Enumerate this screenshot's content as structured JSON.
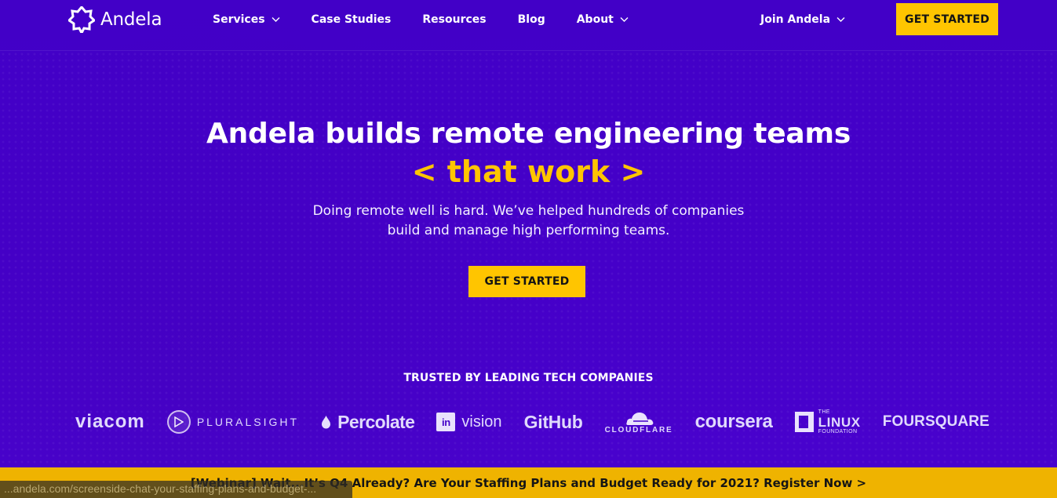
{
  "nav": {
    "brand": "Andela",
    "items": [
      {
        "label": "Services",
        "has_dropdown": true,
        "icon": "chevron-down-icon"
      },
      {
        "label": "Case Studies",
        "has_dropdown": false
      },
      {
        "label": "Resources",
        "has_dropdown": false
      },
      {
        "label": "Blog",
        "has_dropdown": false
      },
      {
        "label": "About",
        "has_dropdown": true,
        "icon": "chevron-down-icon"
      }
    ],
    "join": "Join Andela",
    "cta": "GET STARTED"
  },
  "hero": {
    "title": "Andela builds remote engineering teams",
    "accent": "< that work >",
    "subtitle_line_1": "Doing remote well is hard. We’ve helped hundreds of companies",
    "subtitle_line_2": "build and manage high performing teams.",
    "cta": "GET STARTED"
  },
  "trusted": {
    "heading": "TRUSTED BY LEADING TECH COMPANIES",
    "logos": {
      "viacom": "viacom",
      "pluralsight": "PLURALSIGHT",
      "percolate": "Percolate",
      "invision_mark": "in",
      "invision": "vision",
      "github": "GitHub",
      "cloudflare": "CLOUDFLARE",
      "coursera": "coursera",
      "linux_foundation_top": "THE",
      "linux_foundation_main": "LINUX",
      "linux_foundation_bottom": "FOUNDATION",
      "foursquare": "FOURSQUARE"
    }
  },
  "banner": {
    "text": "[Webinar] Wait...It’s Q4 Already? Are Your Staffing Plans and Budget Ready for 2021? Register Now >"
  },
  "status_bar": {
    "url": "...andela.com/screenside-chat-your-staffing-plans-and-budget-..."
  },
  "colors": {
    "background": "#4300c8",
    "accent": "#ffc500",
    "banner": "#efb300",
    "text": "#ffffff"
  }
}
